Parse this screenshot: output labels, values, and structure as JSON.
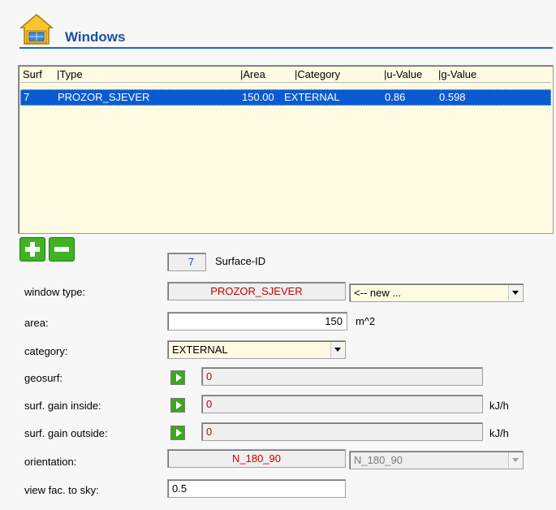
{
  "header": {
    "title": "Windows",
    "icon": "house-window-icon"
  },
  "list": {
    "columns": [
      "Surf",
      "|Type",
      "|Area",
      "|Category",
      "|u-Value",
      "|g-Value"
    ],
    "rows": [
      {
        "surf": "7",
        "type": "PROZOR_SJEVER",
        "area": "150.00",
        "category": "EXTERNAL",
        "u_value": "0.86",
        "g_value": "0.598"
      }
    ]
  },
  "buttons": {
    "add_icon": "plus-icon",
    "remove_icon": "minus-icon"
  },
  "surface_id": {
    "value": "7",
    "label": "Surface-ID"
  },
  "window_type": {
    "label": "window type:",
    "value": "PROZOR_SJEVER",
    "select_value": "<-- new ..."
  },
  "area": {
    "label": "area:",
    "value": "150",
    "unit": "m^2"
  },
  "category": {
    "label": "category:",
    "value": "EXTERNAL"
  },
  "geosurf": {
    "label": "geosurf:",
    "value": "0"
  },
  "surf_gain_inside": {
    "label": "surf. gain inside:",
    "value": "0",
    "unit": "kJ/h"
  },
  "surf_gain_outside": {
    "label": "surf. gain outside:",
    "value": "0",
    "unit": "kJ/h"
  },
  "orientation": {
    "label": "orientation:",
    "value": "N_180_90",
    "select_value": "N_180_90"
  },
  "view_factor": {
    "label": "view fac. to sky:",
    "value": "0.5"
  },
  "colors": {
    "accent": "#1f66c8",
    "selection": "#0a5bd0",
    "list_bg": "#fffbe3",
    "red_text": "#c40000",
    "green": "#40b224"
  }
}
